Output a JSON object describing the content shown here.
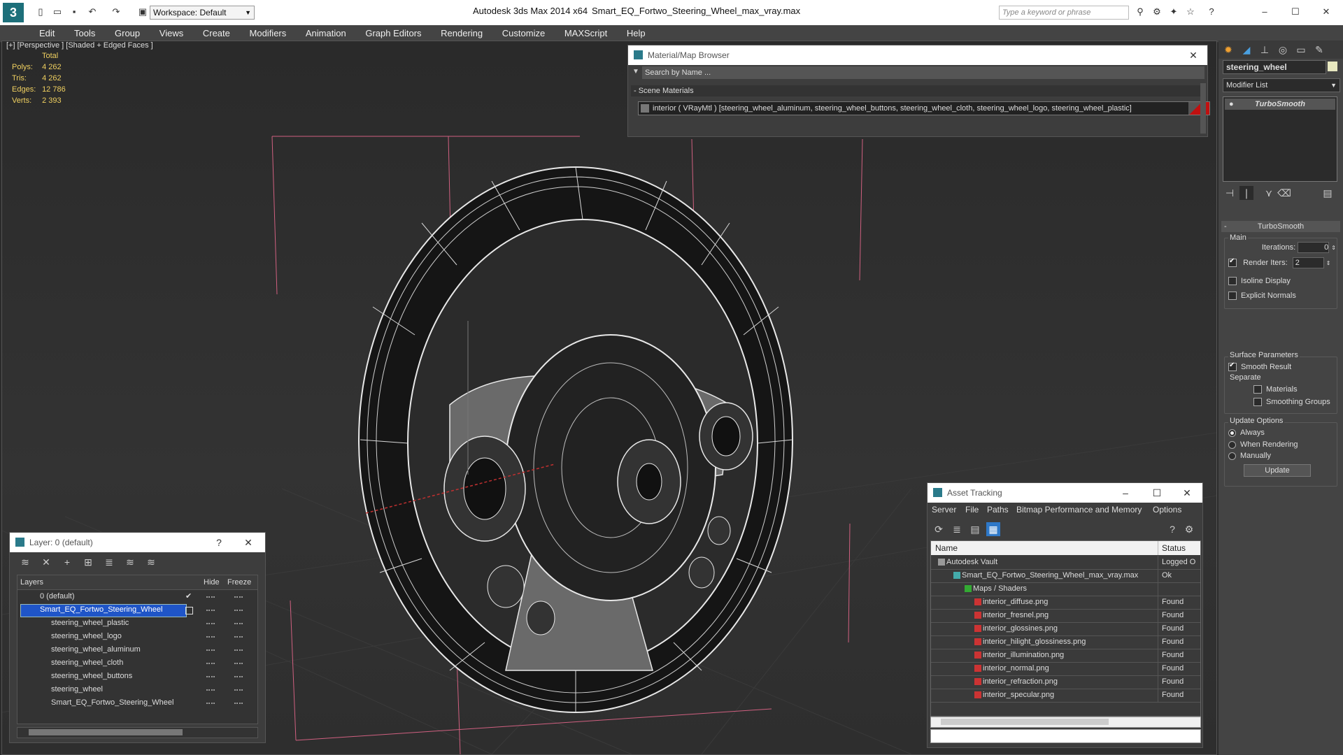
{
  "app": {
    "title": "Autodesk 3ds Max  2014 x64",
    "file": "Smart_EQ_Fortwo_Steering_Wheel_max_vray.max",
    "workspace": "Workspace: Default",
    "search_placeholder": "Type a keyword or phrase"
  },
  "menu": [
    "Edit",
    "Tools",
    "Group",
    "Views",
    "Create",
    "Modifiers",
    "Animation",
    "Graph Editors",
    "Rendering",
    "Customize",
    "MAXScript",
    "Help"
  ],
  "viewport": {
    "label": "[+] [Perspective ] [Shaded + Edged Faces ]",
    "stats": {
      "header": "Total",
      "rows": [
        {
          "label": "Polys:",
          "value": "4 262"
        },
        {
          "label": "Tris:",
          "value": "4 262"
        },
        {
          "label": "Edges:",
          "value": "12 786"
        },
        {
          "label": "Verts:",
          "value": "2 393"
        }
      ]
    }
  },
  "material_browser": {
    "title": "Material/Map Browser",
    "search_placeholder": "Search by Name ...",
    "section": "- Scene Materials",
    "item": "interior  ( VRayMtl ) [steering_wheel_aluminum, steering_wheel_buttons, steering_wheel_cloth, steering_wheel_logo, steering_wheel_plastic]"
  },
  "layers": {
    "title": "Layer: 0 (default)",
    "help": "?",
    "columns": [
      "Layers",
      "Hide",
      "Freeze"
    ],
    "items": [
      "0 (default)",
      "Smart_EQ_Fortwo_Steering_Wheel",
      "steering_wheel_plastic",
      "steering_wheel_logo",
      "steering_wheel_aluminum",
      "steering_wheel_cloth",
      "steering_wheel_buttons",
      "steering_wheel",
      "Smart_EQ_Fortwo_Steering_Wheel"
    ]
  },
  "asset_tracking": {
    "title": "Asset Tracking",
    "menu": [
      "Server",
      "File",
      "Paths",
      "Bitmap Performance and Memory",
      "Options"
    ],
    "columns": [
      "Name",
      "Status"
    ],
    "rows": [
      {
        "name": "Autodesk Vault",
        "status": "Logged O"
      },
      {
        "name": "Smart_EQ_Fortwo_Steering_Wheel_max_vray.max",
        "status": "Ok"
      },
      {
        "name": "Maps / Shaders",
        "status": ""
      },
      {
        "name": "interior_diffuse.png",
        "status": "Found"
      },
      {
        "name": "interior_fresnel.png",
        "status": "Found"
      },
      {
        "name": "interior_glossines.png",
        "status": "Found"
      },
      {
        "name": "interior_hilight_glossiness.png",
        "status": "Found"
      },
      {
        "name": "interior_illumination.png",
        "status": "Found"
      },
      {
        "name": "interior_normal.png",
        "status": "Found"
      },
      {
        "name": "interior_refraction.png",
        "status": "Found"
      },
      {
        "name": "interior_specular.png",
        "status": "Found"
      }
    ]
  },
  "command_panel": {
    "object_name": "steering_wheel",
    "modifier_list": "Modifier List",
    "stack_item": "TurboSmooth",
    "rollout": "TurboSmooth",
    "main": "Main",
    "iterations_label": "Iterations:",
    "iterations": "0",
    "render_iters_label": "Render Iters:",
    "render_iters": "2",
    "isoline": "Isoline Display",
    "explicit": "Explicit Normals",
    "surface": "Surface Parameters",
    "smooth": "Smooth Result",
    "separate": "Separate",
    "materials": "Materials",
    "smoothing_groups": "Smoothing Groups",
    "update_options": "Update Options",
    "always": "Always",
    "when_rendering": "When Rendering",
    "manually": "Manually",
    "update": "Update"
  }
}
